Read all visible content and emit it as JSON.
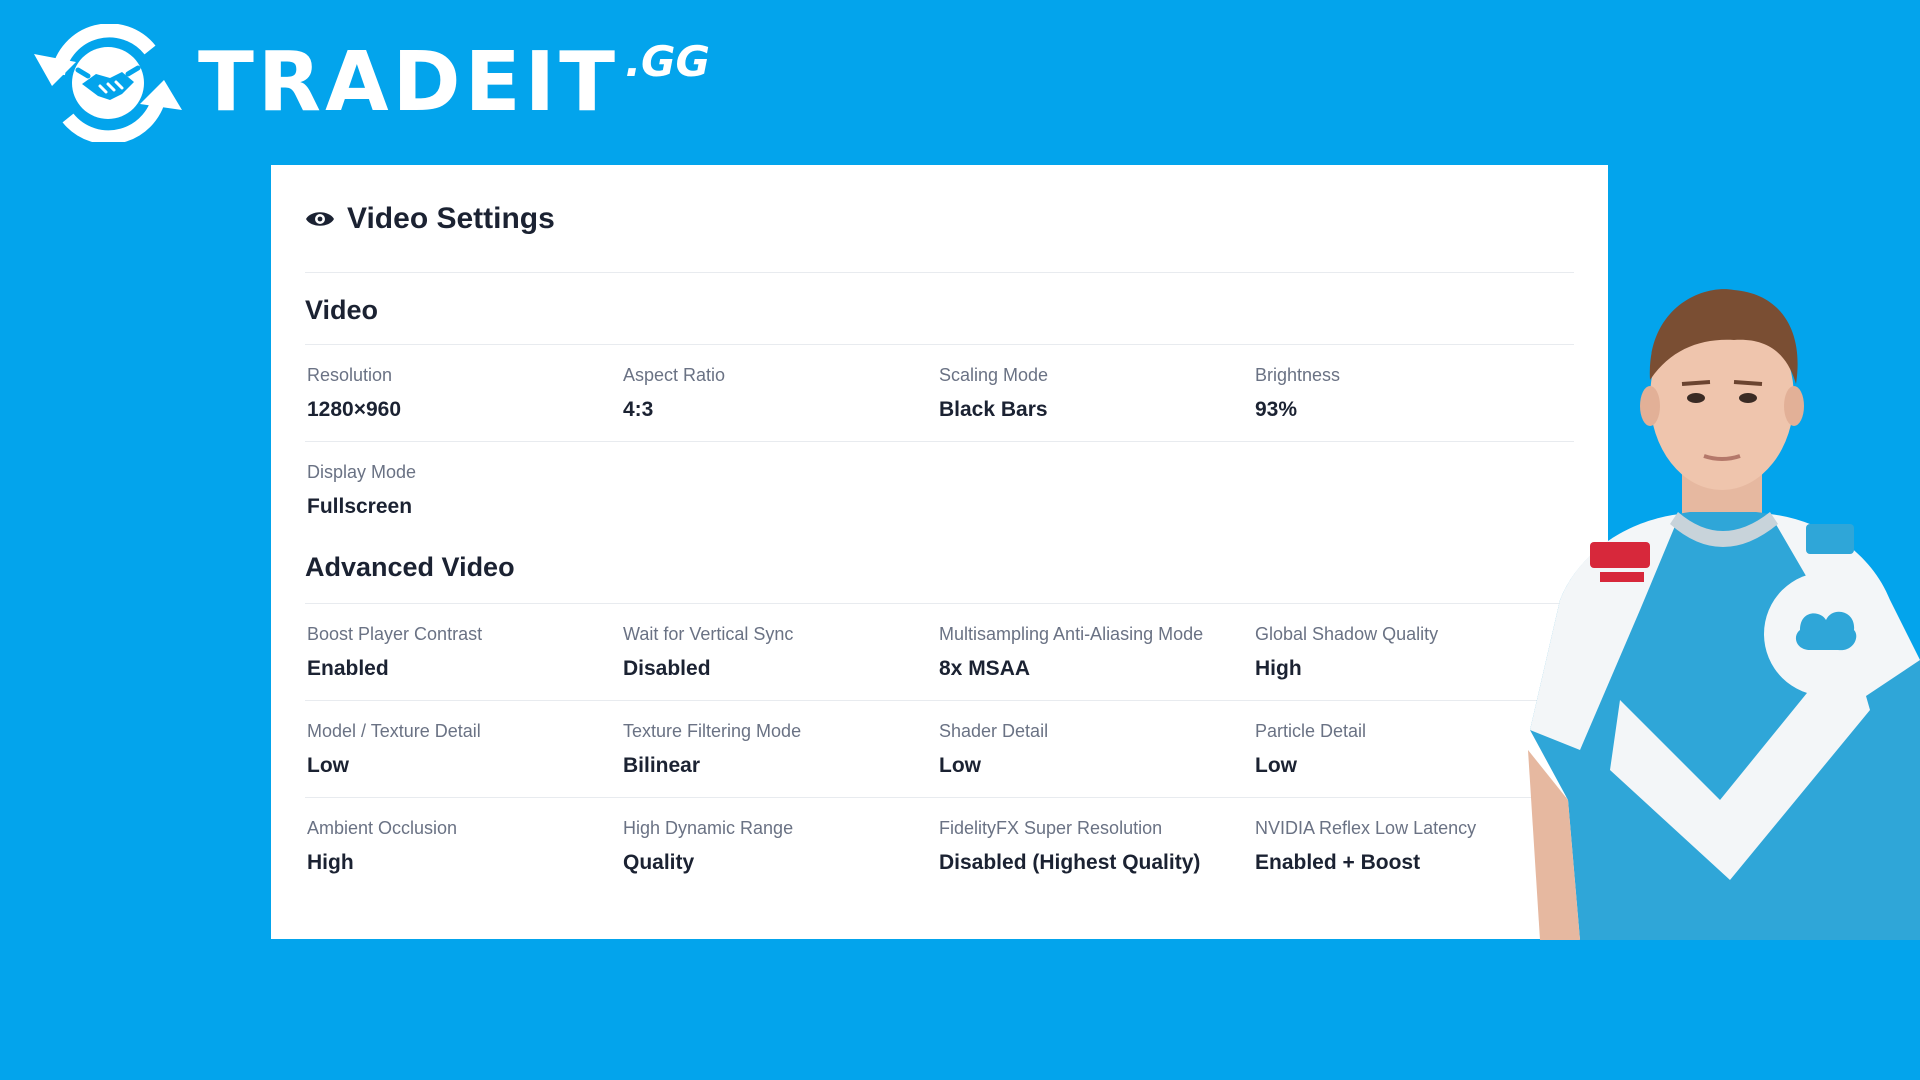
{
  "brand": {
    "logo_text": "TRADEIT",
    "logo_tld": ".GG"
  },
  "card": {
    "title": "Video Settings",
    "icon": "eye-icon"
  },
  "sections": [
    {
      "title": "Video",
      "rows": [
        [
          {
            "label": "Resolution",
            "value": "1280×960"
          },
          {
            "label": "Aspect Ratio",
            "value": "4:3"
          },
          {
            "label": "Scaling Mode",
            "value": "Black Bars"
          },
          {
            "label": "Brightness",
            "value": "93%"
          }
        ],
        [
          {
            "label": "Display Mode",
            "value": "Fullscreen"
          }
        ]
      ]
    },
    {
      "title": "Advanced Video",
      "rows": [
        [
          {
            "label": "Boost Player Contrast",
            "value": "Enabled"
          },
          {
            "label": "Wait for Vertical Sync",
            "value": "Disabled"
          },
          {
            "label": "Multisampling Anti-Aliasing Mode",
            "value": "8x MSAA"
          },
          {
            "label": "Global Shadow Quality",
            "value": "High"
          }
        ],
        [
          {
            "label": "Model / Texture Detail",
            "value": "Low"
          },
          {
            "label": "Texture Filtering Mode",
            "value": "Bilinear"
          },
          {
            "label": "Shader Detail",
            "value": "Low"
          },
          {
            "label": "Particle Detail",
            "value": "Low"
          }
        ],
        [
          {
            "label": "Ambient Occlusion",
            "value": "High"
          },
          {
            "label": "High Dynamic Range",
            "value": "Quality"
          },
          {
            "label": "FidelityFX Super Resolution",
            "value": "Disabled (Highest Quality)"
          },
          {
            "label": "NVIDIA Reflex Low Latency",
            "value": "Enabled + Boost"
          }
        ]
      ]
    }
  ],
  "colors": {
    "background": "#03a4ec",
    "card": "#ffffff",
    "text_primary": "#1b2232",
    "text_label": "#6a7284",
    "divider": "#e8ebef"
  }
}
